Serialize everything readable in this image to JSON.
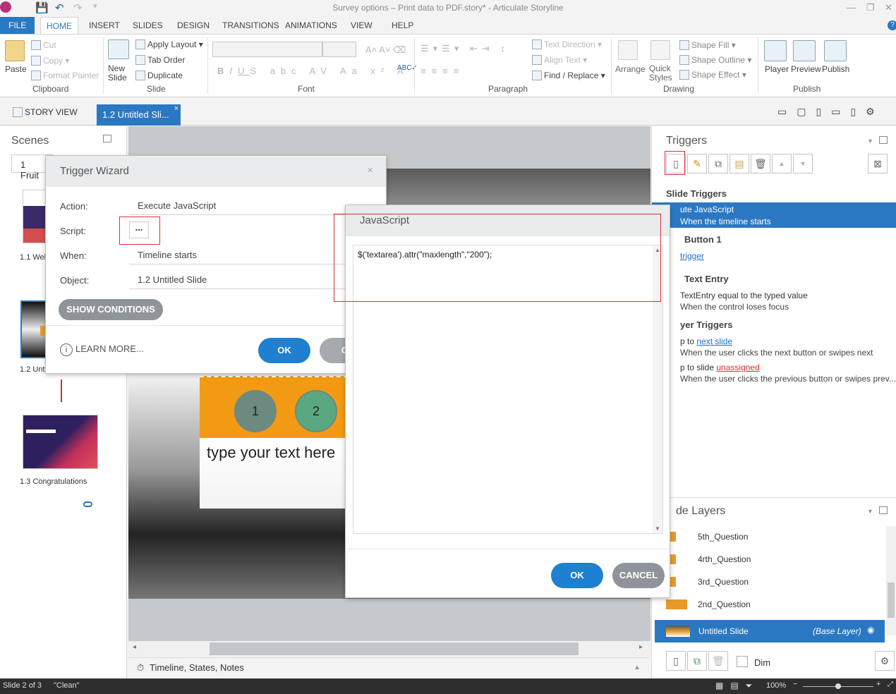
{
  "window": {
    "title": "Survey options – Print data to PDF.story* - Articulate Storyline"
  },
  "tabs": [
    "FILE",
    "HOME",
    "INSERT",
    "SLIDES",
    "DESIGN",
    "TRANSITIONS",
    "ANIMATIONS",
    "VIEW",
    "HELP"
  ],
  "ribbon": {
    "clipboard": {
      "paste": "Paste",
      "cut": "Cut",
      "copy": "Copy",
      "format_painter": "Format Painter",
      "label": "Clipboard"
    },
    "slide": {
      "new_slide": "New Slide",
      "apply_layout": "Apply Layout",
      "tab_order": "Tab Order",
      "duplicate": "Duplicate",
      "label": "Slide"
    },
    "font": {
      "label": "Font"
    },
    "paragraph": {
      "text_direction": "Text Direction",
      "align_text": "Align Text",
      "find_replace": "Find / Replace",
      "label": "Paragraph"
    },
    "drawing": {
      "arrange": "Arrange",
      "quick_styles": "Quick Styles",
      "shape_fill": "Shape Fill",
      "shape_outline": "Shape Outline",
      "shape_effect": "Shape Effect",
      "label": "Drawing"
    },
    "publish": {
      "player": "Player",
      "preview": "Preview",
      "publish": "Publish",
      "label": "Publish"
    }
  },
  "doc_tabs": {
    "story_view": "STORY VIEW",
    "slide_tab": "1.2 Untitled Sli..."
  },
  "scenes": {
    "title": "Scenes",
    "dropdown": "1 Fruit",
    "slides": [
      {
        "label": "1.1 Wel"
      },
      {
        "label": "1.2 Unt"
      },
      {
        "label": "1.3 Congratulations"
      }
    ]
  },
  "slide_canvas": {
    "circle_1": "1",
    "circle_2": "2",
    "text_entry": "type your text here"
  },
  "timeline_bar": "Timeline, States, Notes",
  "trigger_wizard": {
    "title": "Trigger Wizard",
    "action_label": "Action:",
    "action_value": "Execute JavaScript",
    "script_label": "Script:",
    "script_button": "...",
    "when_label": "When:",
    "when_value": "Timeline starts",
    "object_label": "Object:",
    "object_value": "1.2 Untitled Slide",
    "show_conditions": "SHOW CONDITIONS",
    "learn_more": "LEARN MORE...",
    "ok": "OK",
    "cancel": "CAN"
  },
  "javascript_dialog": {
    "title": "JavaScript",
    "code": "$('textarea').attr(\"maxlength\",\"200\");",
    "ok": "OK",
    "cancel": "CANCEL"
  },
  "triggers_panel": {
    "title": "Triggers",
    "slide_triggers_heading": "Slide Triggers",
    "items": [
      {
        "main": "ute JavaScript",
        "sub": "When the timeline starts"
      },
      {
        "heading": "Button 1",
        "link": "trigger"
      },
      {
        "heading": "Text Entry",
        "main": "TextEntry equal to the typed value",
        "sub": "When the control loses focus"
      }
    ],
    "player_heading": "yer Triggers",
    "player_items": [
      {
        "prefix": "p to",
        "link": "next slide",
        "sub": "When the user clicks the next button or swipes next"
      },
      {
        "prefix": "p to slide",
        "link": "unassigned",
        "sub": "When the user clicks the previous button or swipes prev..."
      }
    ]
  },
  "layers_panel": {
    "title": "de Layers",
    "layers": [
      "5th_Question",
      "4rth_Question",
      "3rd_Question",
      "2nd_Question"
    ],
    "base": {
      "name": "Untitled Slide",
      "tag": "(Base Layer)"
    },
    "dim": "Dim"
  },
  "status": {
    "slide": "Slide 2 of 3",
    "theme": "\"Clean\"",
    "zoom": "100%"
  }
}
